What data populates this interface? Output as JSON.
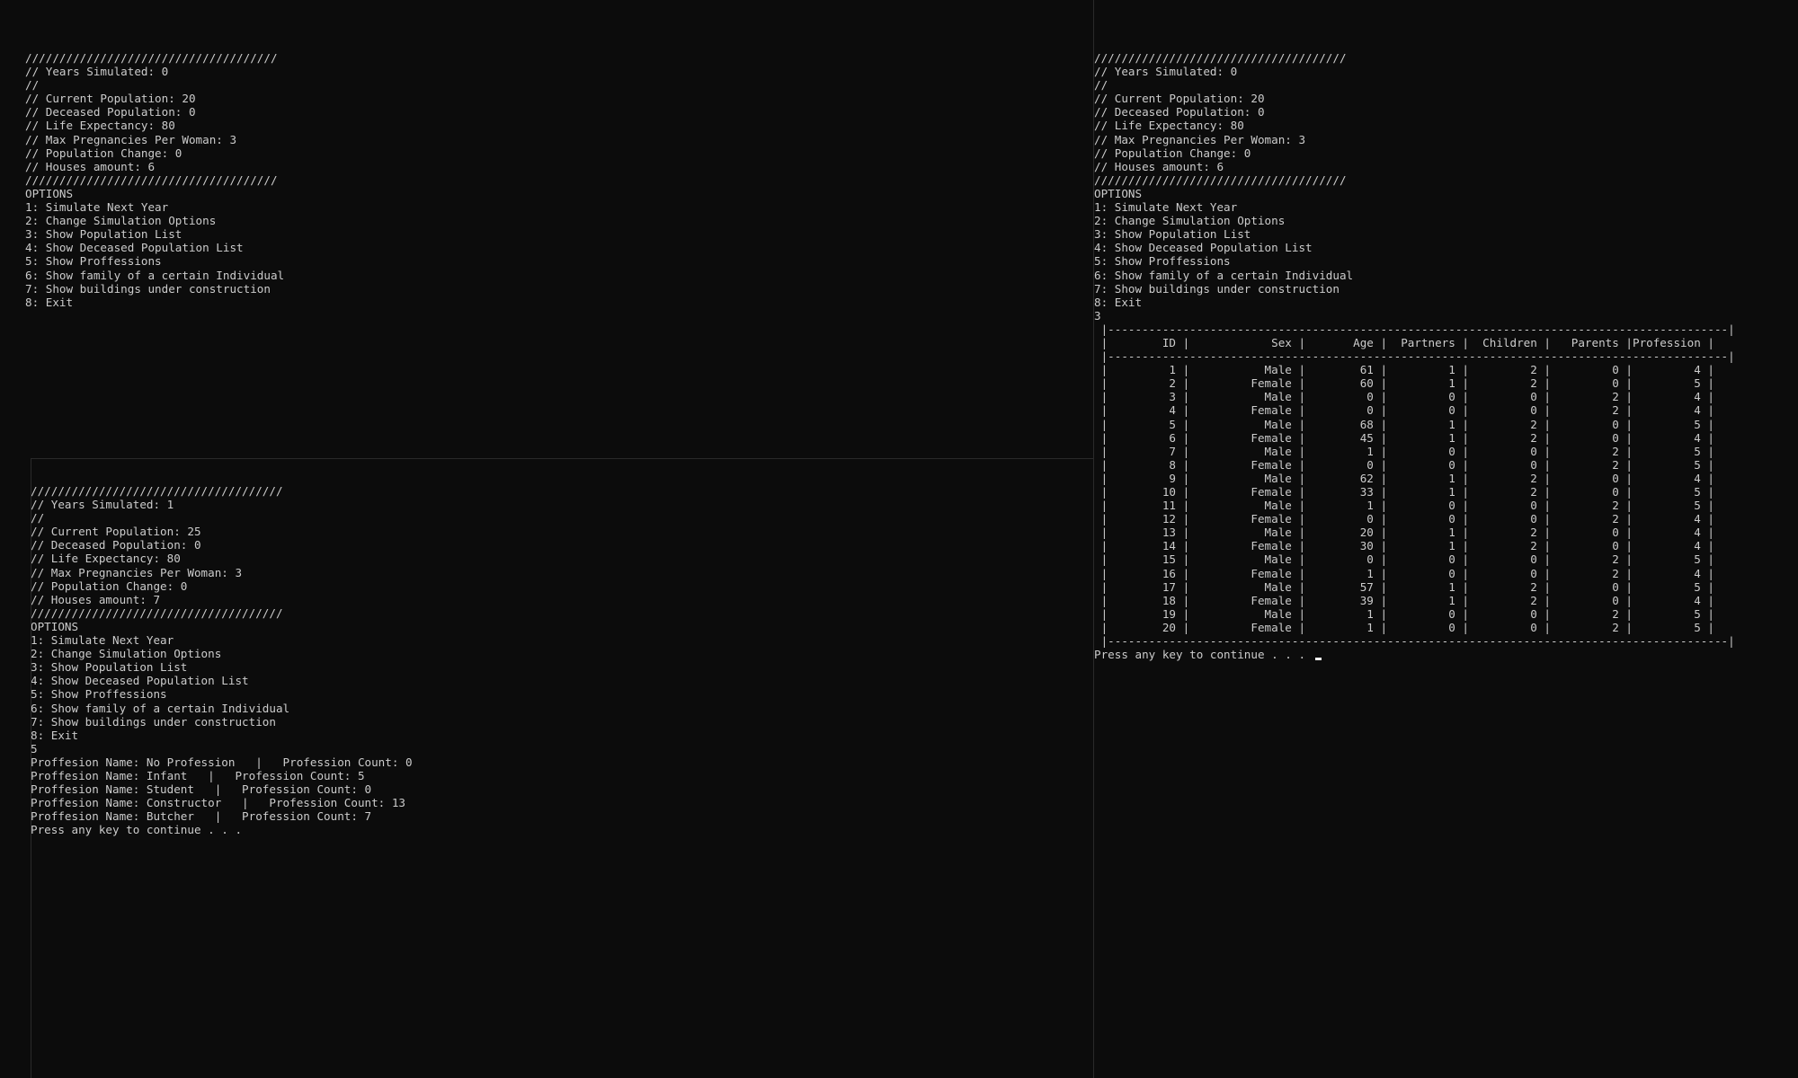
{
  "top_left": {
    "lines": [
      "/////////////////////////////////////",
      "// Years Simulated: 0",
      "//",
      "// Current Population: 20",
      "// Deceased Population: 0",
      "// Life Expectancy: 80",
      "// Max Pregnancies Per Woman: 3",
      "// Population Change: 0",
      "// Houses amount: 6",
      "/////////////////////////////////////",
      "OPTIONS",
      "1: Simulate Next Year",
      "2: Change Simulation Options",
      "3: Show Population List",
      "4: Show Deceased Population List",
      "5: Show Proffessions",
      "6: Show family of a certain Individual",
      "7: Show buildings under construction",
      "8: Exit"
    ]
  },
  "bottom_left": {
    "lines": [
      "/////////////////////////////////////",
      "// Years Simulated: 1",
      "//",
      "// Current Population: 25",
      "// Deceased Population: 0",
      "// Life Expectancy: 80",
      "// Max Pregnancies Per Woman: 3",
      "// Population Change: 0",
      "// Houses amount: 7",
      "/////////////////////////////////////",
      "OPTIONS",
      "1: Simulate Next Year",
      "2: Change Simulation Options",
      "3: Show Population List",
      "4: Show Deceased Population List",
      "5: Show Proffessions",
      "6: Show family of a certain Individual",
      "7: Show buildings under construction",
      "8: Exit",
      "5",
      "Proffesion Name: No Profession   |   Profession Count: 0",
      "Proffesion Name: Infant   |   Profession Count: 5",
      "Proffesion Name: Student   |   Profession Count: 0",
      "Proffesion Name: Constructor   |   Profession Count: 13",
      "Proffesion Name: Butcher   |   Profession Count: 7",
      "Press any key to continue . . ."
    ]
  },
  "right": {
    "lines": [
      "/////////////////////////////////////",
      "// Years Simulated: 0",
      "//",
      "// Current Population: 20",
      "// Deceased Population: 0",
      "// Life Expectancy: 80",
      "// Max Pregnancies Per Woman: 3",
      "// Population Change: 0",
      "// Houses amount: 6",
      "/////////////////////////////////////",
      "OPTIONS",
      "1: Simulate Next Year",
      "2: Change Simulation Options",
      "3: Show Population List",
      "4: Show Deceased Population List",
      "5: Show Proffessions",
      "6: Show family of a certain Individual",
      "7: Show buildings under construction",
      "8: Exit",
      "3",
      " |-------------------------------------------------------------------------------------------|",
      " |        ID |            Sex |       Age |  Partners |  Children |   Parents |Profession |",
      " |-------------------------------------------------------------------------------------------|",
      " |         1 |           Male |        61 |         1 |         2 |         0 |         4 |",
      " |         2 |         Female |        60 |         1 |         2 |         0 |         5 |",
      " |         3 |           Male |         0 |         0 |         0 |         2 |         4 |",
      " |         4 |         Female |         0 |         0 |         0 |         2 |         4 |",
      " |         5 |           Male |        68 |         1 |         2 |         0 |         5 |",
      " |         6 |         Female |        45 |         1 |         2 |         0 |         4 |",
      " |         7 |           Male |         1 |         0 |         0 |         2 |         5 |",
      " |         8 |         Female |         0 |         0 |         0 |         2 |         5 |",
      " |         9 |           Male |        62 |         1 |         2 |         0 |         4 |",
      " |        10 |         Female |        33 |         1 |         2 |         0 |         5 |",
      " |        11 |           Male |         1 |         0 |         0 |         2 |         5 |",
      " |        12 |         Female |         0 |         0 |         0 |         2 |         4 |",
      " |        13 |           Male |        20 |         1 |         2 |         0 |         4 |",
      " |        14 |         Female |        30 |         1 |         2 |         0 |         4 |",
      " |        15 |           Male |         0 |         0 |         0 |         2 |         5 |",
      " |        16 |         Female |         1 |         0 |         0 |         2 |         4 |",
      " |        17 |           Male |        57 |         1 |         2 |         0 |         5 |",
      " |        18 |         Female |        39 |         1 |         2 |         0 |         4 |",
      " |        19 |           Male |         1 |         0 |         0 |         2 |         5 |",
      " |        20 |         Female |         1 |         0 |         0 |         2 |         5 |",
      " |-------------------------------------------------------------------------------------------|"
    ],
    "prompt": "Press any key to continue . . . "
  }
}
